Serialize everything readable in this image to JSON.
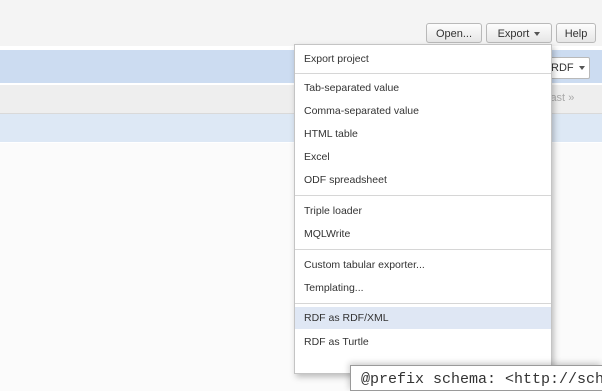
{
  "toolbar": {
    "open_label": "Open...",
    "export_label": "Export",
    "help_label": "Help"
  },
  "blue_bar": {
    "right_label": "RDF"
  },
  "gray_bar": {
    "right_label": "last"
  },
  "export_menu": {
    "items": [
      {
        "label": "Export project"
      },
      {
        "label": "Tab-separated value"
      },
      {
        "label": "Comma-separated value"
      },
      {
        "label": "HTML table"
      },
      {
        "label": "Excel"
      },
      {
        "label": "ODF spreadsheet"
      },
      {
        "label": "Triple loader"
      },
      {
        "label": "MQLWrite"
      },
      {
        "label": "Custom tabular exporter..."
      },
      {
        "label": "Templating..."
      },
      {
        "label": "RDF as RDF/XML"
      },
      {
        "label": "RDF as Turtle"
      }
    ],
    "highlighted_index": 10
  },
  "code_preview": {
    "text": "@prefix schema: <http://sch"
  },
  "colors": {
    "blue_bar": "#ccdcf1",
    "highlight": "#dfe7f4",
    "menu_border": "#c4c4c4"
  },
  "icons": {
    "dropdown": "caret-down-icon"
  }
}
